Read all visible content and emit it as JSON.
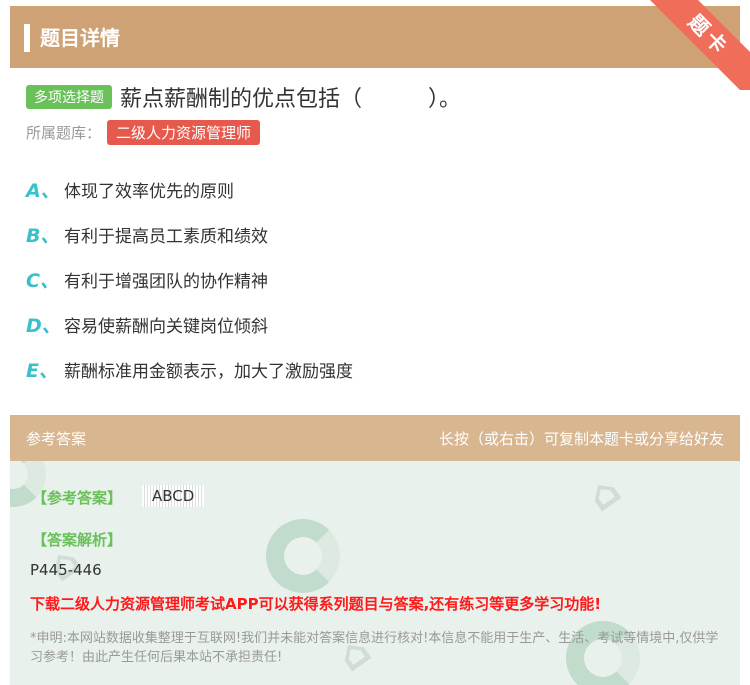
{
  "header": {
    "title": "题目详情",
    "ribbon": "题卡"
  },
  "question": {
    "type_tag": "多项选择题",
    "text": "薪点薪酬制的优点包括（　　　）。",
    "bank_label": "所属题库：",
    "bank_name": "二级人力资源管理师"
  },
  "options": [
    {
      "letter": "A、",
      "text": "体现了效率优先的原则"
    },
    {
      "letter": "B、",
      "text": "有利于提高员工素质和绩效"
    },
    {
      "letter": "C、",
      "text": "有利于增强团队的协作精神"
    },
    {
      "letter": "D、",
      "text": "容易使薪酬向关键岗位倾斜"
    },
    {
      "letter": "E、",
      "text": "薪酬标准用金额表示，加大了激励强度"
    }
  ],
  "answer_section": {
    "title": "参考答案",
    "share_hint": "长按（或右击）可复制本题卡或分享给好友",
    "answer_label": "【参考答案】",
    "answer_value": "ABCD",
    "analysis_label": "【答案解析】",
    "page_ref": "P445-446",
    "promo": "下载二级人力资源管理师考试APP可以获得系列题目与答案,还有练习等更多学习功能!",
    "disclaimer": "*申明:本网站数据收集整理于互联网!我们并未能对答案信息进行核对!本信息不能用于生产、生活、考试等情境中,仅供学习参考！由此产生任何后果本站不承担责任!"
  },
  "colors": {
    "header": "#cfa276",
    "tag_green": "#6ac15a",
    "tag_red": "#e65a4d",
    "option_letter": "#39c0c8",
    "promo_red": "#ff1a1a"
  }
}
